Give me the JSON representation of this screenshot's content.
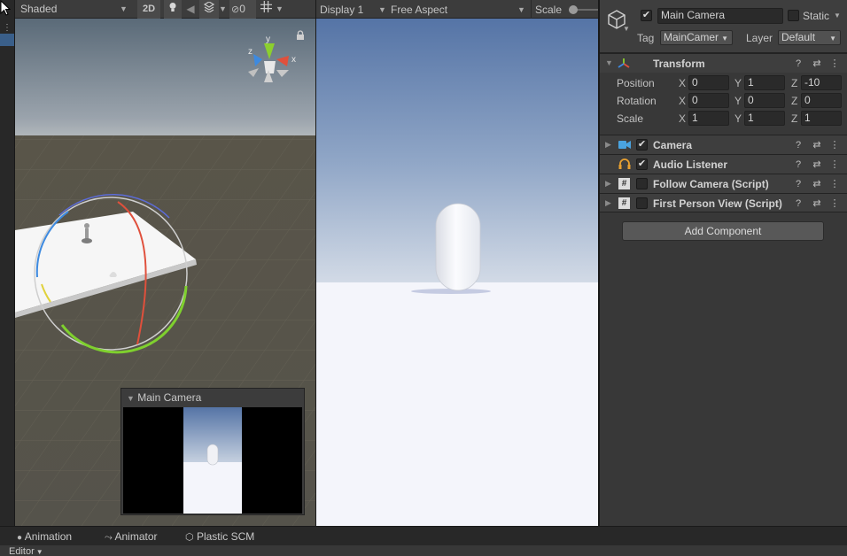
{
  "scene_toolbar": {
    "shading_mode": "Shaded",
    "mode_2d": "2D",
    "hidden_count": "0"
  },
  "game_toolbar": {
    "display": "Display 1",
    "aspect": "Free Aspect",
    "scale_label": "Scale"
  },
  "gizmo": {
    "y": "y",
    "x": "x",
    "z": "z"
  },
  "camera_preview": {
    "title": "Main Camera"
  },
  "inspector": {
    "object_name": "Main Camera",
    "static_label": "Static",
    "tag_label": "Tag",
    "tag_value": "MainCamer",
    "layer_label": "Layer",
    "layer_value": "Default",
    "transform": {
      "title": "Transform",
      "position_label": "Position",
      "rotation_label": "Rotation",
      "scale_label": "Scale",
      "x_label": "X",
      "y_label": "Y",
      "z_label": "Z",
      "position": {
        "x": "0",
        "y": "1",
        "z": "-10"
      },
      "rotation": {
        "x": "0",
        "y": "0",
        "z": "0"
      },
      "scale": {
        "x": "1",
        "y": "1",
        "z": "1"
      }
    },
    "components": [
      {
        "name": "Camera",
        "enabled": true
      },
      {
        "name": "Audio Listener",
        "enabled": true
      },
      {
        "name": "Follow Camera (Script)",
        "enabled": false
      },
      {
        "name": "First Person View (Script)",
        "enabled": false
      }
    ],
    "add_component": "Add Component"
  },
  "bottom_tabs": [
    "Animation",
    "Animator",
    "Plastic SCM"
  ],
  "status_bar": {
    "editor_label": "Editor"
  },
  "colors": {
    "panel": "#383838",
    "toolbar": "#3c3c3c",
    "sky_top": "#5574a6",
    "ground": "#f4f5fb",
    "axis_x": "#e0503c",
    "axis_y": "#8ccf2e",
    "axis_z": "#3d8ae0"
  }
}
